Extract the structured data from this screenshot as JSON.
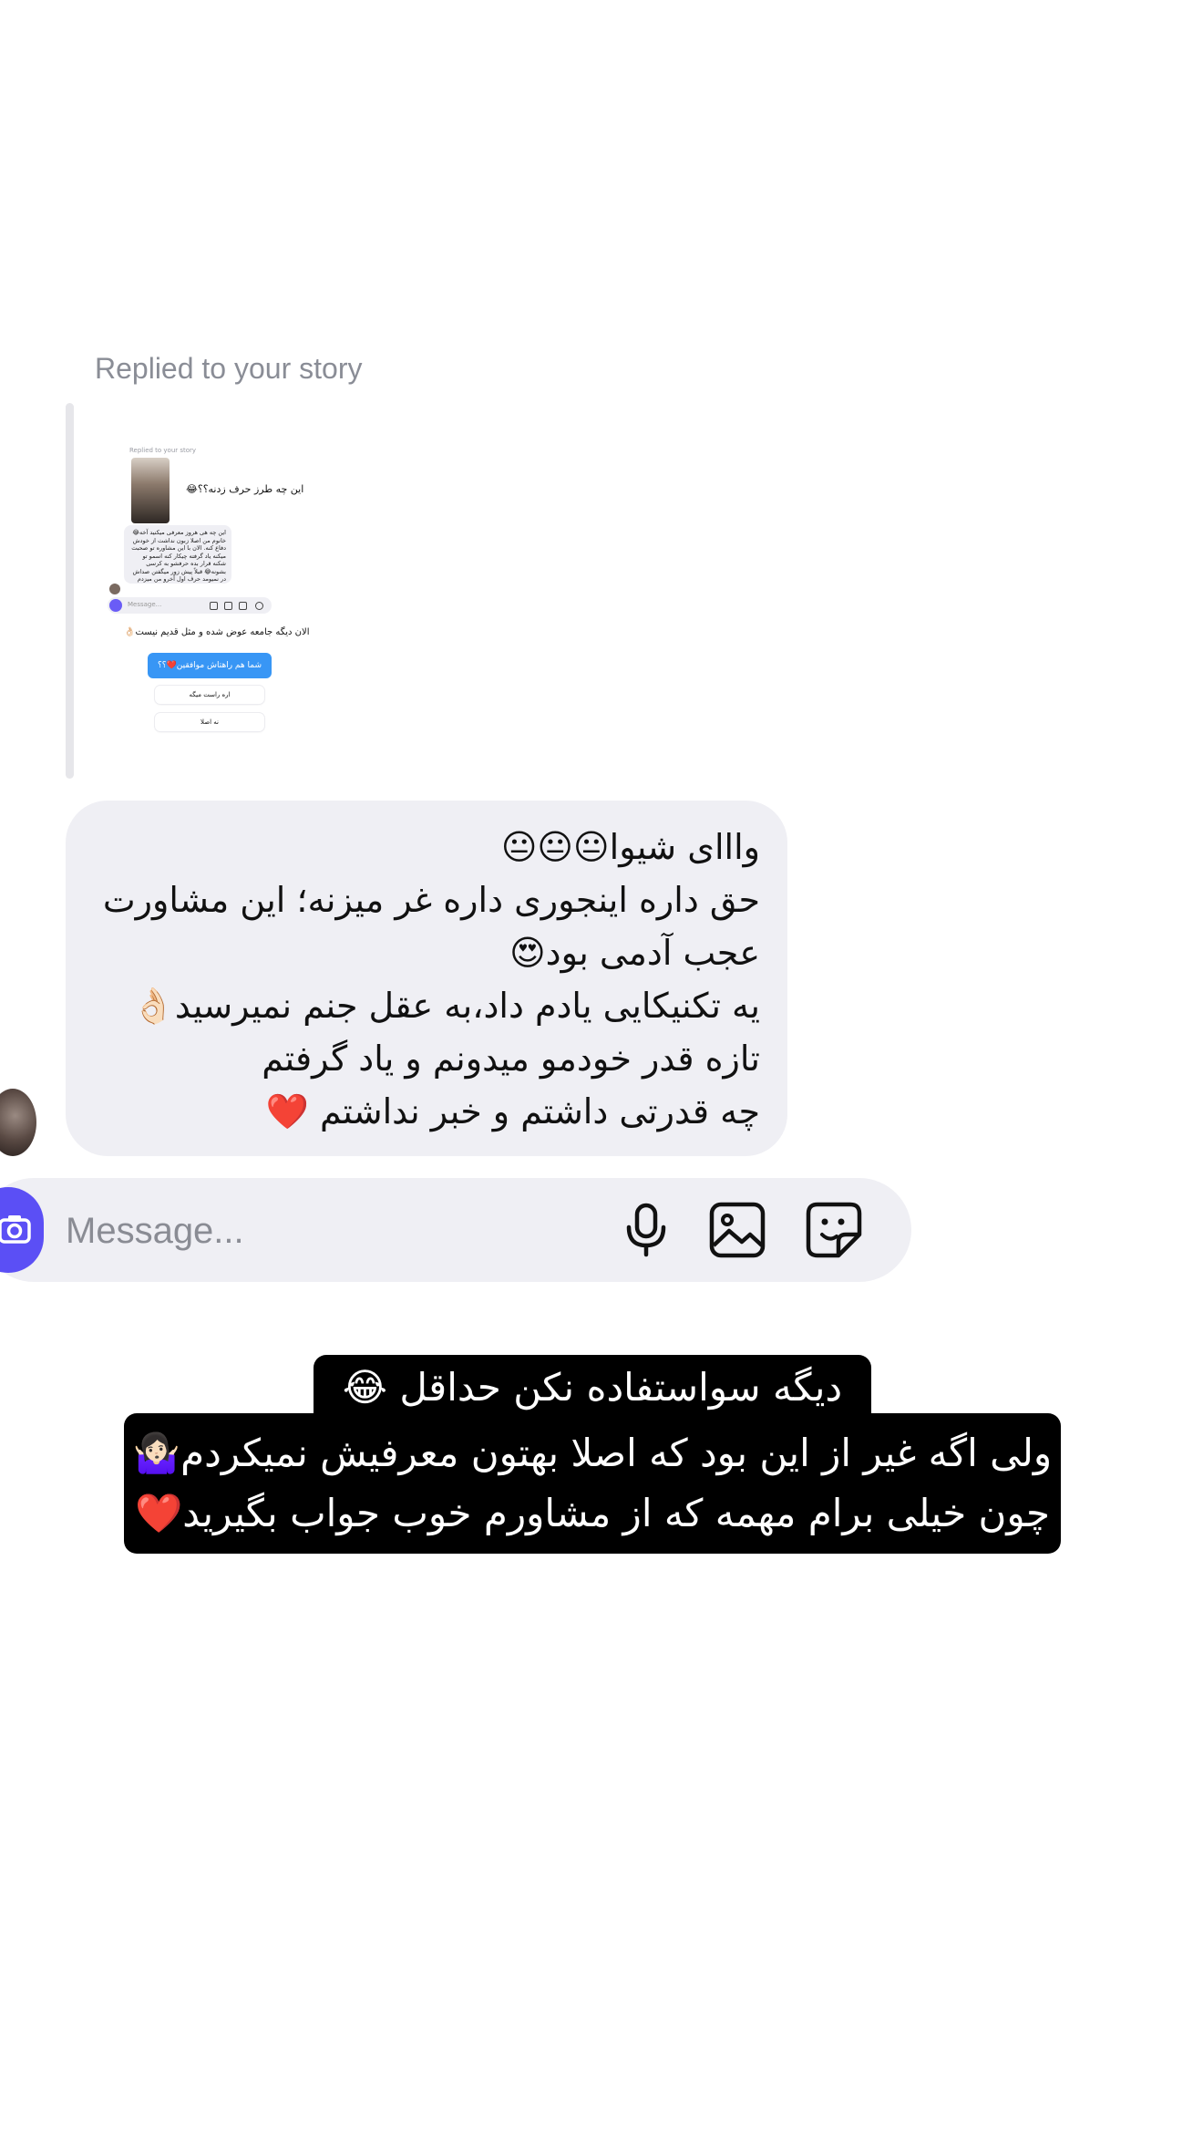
{
  "thread": {
    "replied_label": "Replied to your story",
    "story_preview": {
      "replied_label": "Replied to your story",
      "question": "این چه طرز حرف زدنه؟؟😂",
      "bubble_text": "این چه هی هروز معرفی میکنید آخه😂 خانوم من اصلا زبون نداشت از خودش دفاع کنه. الان با این مشاوره تو صحبت میکنه یاد گرفته چیکار کنه اسمو تو شکنه قرار بده حرفشو به کرسی بشونه😂 قبلاً پیش زور میگفتن صداش در نمیومد حرف اول آخرو من میزدم",
      "input_placeholder": "Message...",
      "line2": "الان دیگه جامعه عوض شده و مثل قدیم نیست👌🏻",
      "blue_text": "شما هم راهتاش موافقین❤️؟؟",
      "option1": "اره راست میگه",
      "option2": "نه اصلا"
    },
    "message_lines": [
      "وااای شیوا😐😐😐",
      "حق داره اینجوری داره غر میزنه؛ این مشاورت",
      "عجب آدمی بود😍",
      "یه تکنیکایی یادم داد،به عقل جنم نمیرسید👌🏻",
      "تازه قدر خودمو میدونم و یاد گرفتم",
      "چه قدرتی داشتم و خبر نداشتم ❤️"
    ]
  },
  "composer": {
    "placeholder": "Message...",
    "icons": [
      "camera-icon",
      "microphone-icon",
      "gallery-icon",
      "sticker-icon"
    ]
  },
  "caption": {
    "line1": "دیگه سواستفاده نکن حداقل 😂",
    "line2": "ولی اگه غیر از این بود که اصلا بهتون معرفیش نمیکردم🤷🏻‍♀️",
    "line3": "چون خیلی برام مهمه که از مشاورم خوب جواب بگیرید❤️"
  },
  "colors": {
    "bubble": "#efeff4",
    "camera_button": "#5b4ff5",
    "caption_bg": "#000000",
    "caption_text": "#ffffff",
    "meta_text": "#8a8d96"
  }
}
